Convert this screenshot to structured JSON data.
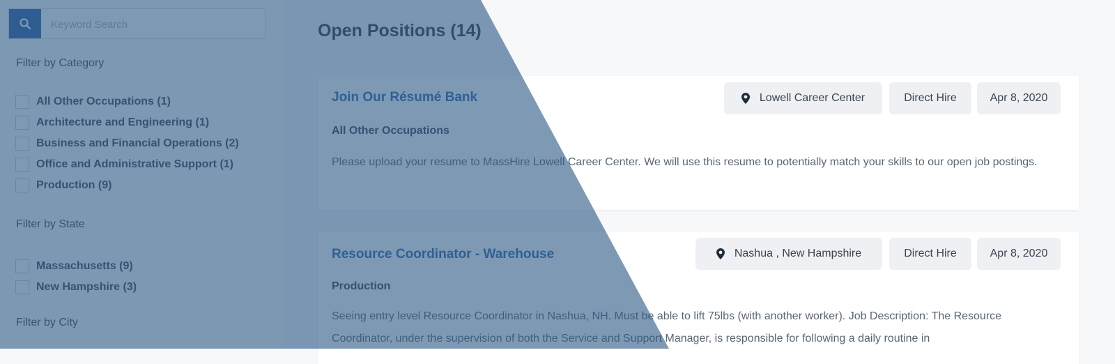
{
  "search": {
    "placeholder": "Keyword Search"
  },
  "filters": {
    "category": {
      "heading": "Filter by Category",
      "items": [
        "All Other Occupations (1)",
        "Architecture and Engineering (1)",
        "Business and Financial Operations (2)",
        "Office and Administrative Support (1)",
        "Production (9)"
      ]
    },
    "state": {
      "heading": "Filter by State",
      "items": [
        "Massachusetts (9)",
        "New Hampshire (3)"
      ]
    },
    "city": {
      "heading": "Filter by City"
    }
  },
  "main": {
    "title": "Open Positions (14)",
    "jobs": [
      {
        "title": "Join Our Résumé Bank",
        "location": "Lowell Career Center",
        "type": "Direct Hire",
        "date": "Apr 8, 2020",
        "category": "All Other Occupations",
        "description": "Please upload your resume to MassHire Lowell Career Center.   We will use this resume to potentially match your skills to our open job postings."
      },
      {
        "title": "Resource Coordinator - Warehouse",
        "location": "Nashua , New Hampshire",
        "type": "Direct Hire",
        "date": "Apr 8, 2020",
        "category": "Production",
        "description": "Seeing entry level Resource Coordinator in Nashua, NH. Must be able to lift 75lbs (with another worker). Job Description: The Resource Coordinator, under the supervision of both the Service and Support Manager, is responsible for following a daily routine in"
      }
    ]
  },
  "icons": {
    "search": "search-icon",
    "location": "map-pin-icon"
  },
  "colors": {
    "accent": "#2f63a6",
    "link": "#2f6aa8",
    "overlay": "#2f5b86"
  }
}
